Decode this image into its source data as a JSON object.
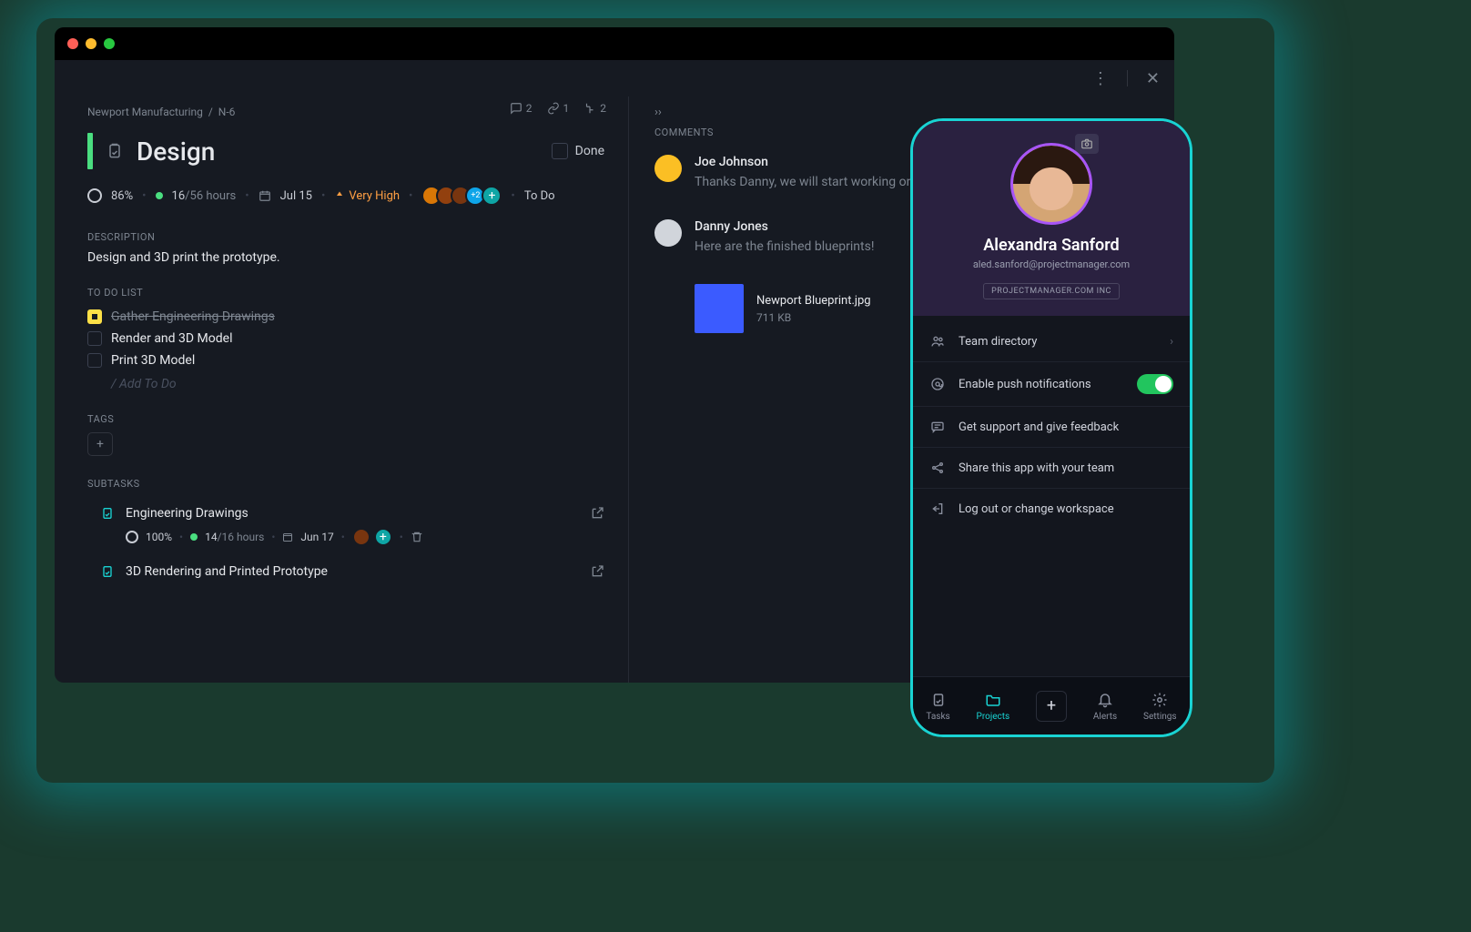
{
  "desktop": {
    "breadcrumb": {
      "project": "Newport Manufacturing",
      "sep": "/",
      "code": "N-6"
    },
    "stats": {
      "comments": "2",
      "links": "1",
      "subtasks": "2"
    },
    "title": "Design",
    "done_label": "Done",
    "meta": {
      "percent": "86%",
      "hours_done": "16",
      "hours_sep": "/56 hours",
      "date": "Jul 15",
      "priority": "Very High",
      "extra_count": "+2",
      "status": "To Do"
    },
    "description": {
      "label": "DESCRIPTION",
      "text": "Design and 3D print the prototype."
    },
    "todo": {
      "label": "TO DO LIST",
      "items": [
        {
          "text": "Gather Engineering Drawings",
          "done": true
        },
        {
          "text": "Render and 3D Model",
          "done": false
        },
        {
          "text": "Print 3D Model",
          "done": false
        }
      ],
      "add_placeholder": "/ Add To Do"
    },
    "tags": {
      "label": "TAGS"
    },
    "subtasks": {
      "label": "SUBTASKS",
      "items": [
        {
          "title": "Engineering Drawings",
          "percent": "100%",
          "hours_done": "14",
          "hours_sep": "/16 hours",
          "date": "Jun 17"
        },
        {
          "title": "3D Rendering and Printed Prototype"
        }
      ]
    },
    "comments": {
      "label": "COMMENTS",
      "items": [
        {
          "name": "Joe Johnson",
          "text": "Thanks Danny, we will start working on the Models!"
        },
        {
          "name": "Danny Jones",
          "text": "Here are the finished blueprints!"
        }
      ],
      "attachment": {
        "filename": "Newport Blueprint.jpg",
        "size": "711 KB"
      }
    }
  },
  "mobile": {
    "profile": {
      "name": "Alexandra Sanford",
      "email": "aled.sanford@projectmanager.com",
      "badge": "PROJECTMANAGER.COM INC"
    },
    "menu": [
      {
        "label": "Team directory",
        "kind": "chevron"
      },
      {
        "label": "Enable push notifications",
        "kind": "toggle"
      },
      {
        "label": "Get support and give feedback",
        "kind": "none"
      },
      {
        "label": "Share this app with your team",
        "kind": "none"
      },
      {
        "label": "Log out or change workspace",
        "kind": "none"
      }
    ],
    "tabs": {
      "tasks": "Tasks",
      "projects": "Projects",
      "alerts": "Alerts",
      "settings": "Settings"
    }
  }
}
